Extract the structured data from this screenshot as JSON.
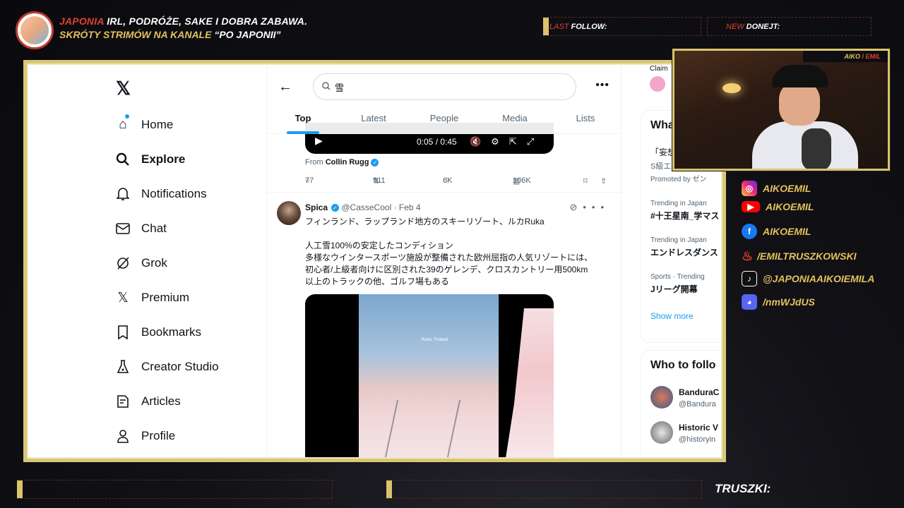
{
  "overlay": {
    "title_accent": "JAPONIA",
    "title_rest": " IRL, PODRÓŻE, SAKE I DOBRA ZABAWA.",
    "subtitle_prefix": "SKRÓTY STRIMÓW NA KANALE ",
    "subtitle_quote": "“PO JAPONII”",
    "last_follow_prefix": "LAST ",
    "last_follow_label": "FOLLOW:",
    "new_donejt_prefix": "NEW ",
    "new_donejt_label": "DONEJT:",
    "cam_label_1": "AIKO",
    "cam_label_sep": " I ",
    "cam_label_2": "EMIL",
    "bottom_label": "TRUSZKI:",
    "accent_color": "#e2402c",
    "gold_color": "#e3c25b"
  },
  "socials": [
    {
      "icon": "instagram-icon",
      "handle": "AIKOEMIL",
      "color": "#c13584"
    },
    {
      "icon": "youtube-icon",
      "handle": "AIKOEMIL",
      "color": "#ff0000"
    },
    {
      "icon": "facebook-icon",
      "handle": "AIKOEMIL",
      "color": "#1877f2"
    },
    {
      "icon": "flame-icon",
      "handle": "/EMILTRUSZKOWSKI",
      "color": "#e2402c"
    },
    {
      "icon": "tiktok-icon",
      "handle": "@JAPONIAAIKOIEMILA",
      "color": "#111111"
    },
    {
      "icon": "discord-icon",
      "handle": "/nmWJdUS",
      "color": "#5865f2"
    }
  ],
  "sidebar": {
    "items": [
      {
        "label": "Home",
        "icon": "home-icon"
      },
      {
        "label": "Explore",
        "icon": "search-icon"
      },
      {
        "label": "Notifications",
        "icon": "bell-icon"
      },
      {
        "label": "Chat",
        "icon": "mail-icon"
      },
      {
        "label": "Grok",
        "icon": "grok-icon"
      },
      {
        "label": "Premium",
        "icon": "x-icon"
      },
      {
        "label": "Bookmarks",
        "icon": "bookmark-icon"
      },
      {
        "label": "Creator Studio",
        "icon": "flask-icon"
      },
      {
        "label": "Articles",
        "icon": "article-icon"
      },
      {
        "label": "Profile",
        "icon": "person-icon"
      }
    ]
  },
  "search": {
    "value": "雪"
  },
  "tabs": [
    "Top",
    "Latest",
    "People",
    "Media",
    "Lists"
  ],
  "video": {
    "time": "0:05 / 0:45"
  },
  "tweet1": {
    "from_prefix": "From ",
    "from_name": "Collin Rugg",
    "replies": "77",
    "reposts": "911",
    "likes": "6K",
    "views": "106K"
  },
  "tweet2": {
    "name": "Spica",
    "handle": "@CasseCool · Feb 4",
    "line1": "フィンランド、ラップランド地方のスキーリゾート、ルカRuka",
    "line2": "人工雪100%の安定したコンディション",
    "line3": "多様なウインタースポーツ施設が整備された欧州屈指の人気リゾートには、",
    "line4": "初心者/上級者向けに区別された39のゲレンデ、クロスカントリー用500km",
    "line5": "以上のトラックの他、ゴルフ場もある",
    "media_tag": "Ruka, Finland"
  },
  "right": {
    "top_cut": "Claim",
    "whats_head": "What",
    "promo_line1": "「妄想",
    "promo_line2": "S級エ",
    "promoted": "Promoted by ゼン",
    "trends": [
      {
        "meta": "Trending in Japan",
        "title": "#十王星南_学マス"
      },
      {
        "meta": "Trending in Japan",
        "title": "エンドレスダンス"
      },
      {
        "meta": "Sports · Trending",
        "title": "Jリーグ開幕"
      }
    ],
    "show_more": "Show more",
    "who_head": "Who to follo",
    "follows": [
      {
        "name": "BanduraC",
        "handle": "@Bandura"
      },
      {
        "name": "Historic V",
        "handle": "@historyin"
      }
    ]
  }
}
